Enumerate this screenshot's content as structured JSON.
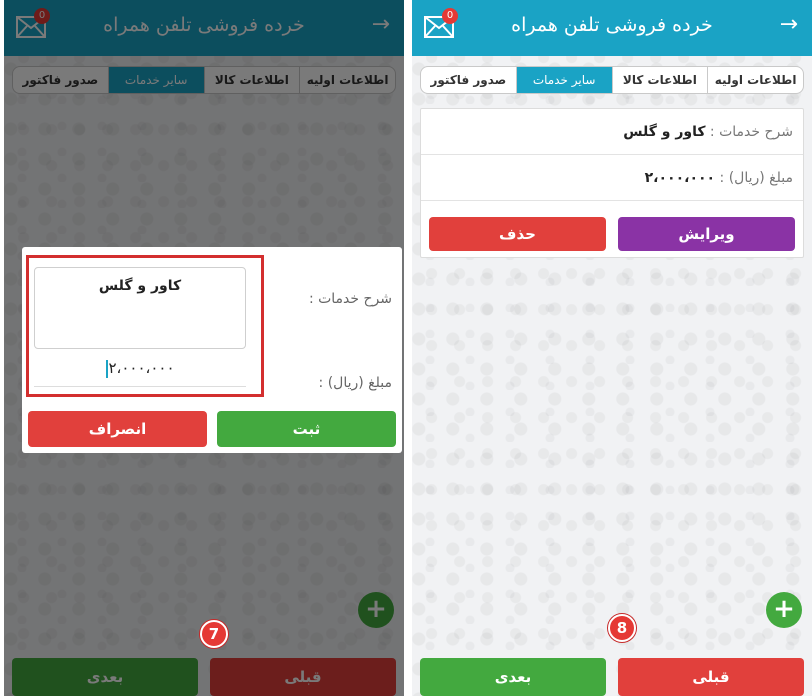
{
  "app": {
    "title": "خرده فروشی تلفن همراه",
    "back_icon": "→",
    "mail_badge": "0"
  },
  "tabs": [
    {
      "label": "اطلاعات اولیه"
    },
    {
      "label": "اطلاعات کالا"
    },
    {
      "label": "سایر خدمات"
    },
    {
      "label": "صدور فاکتور"
    }
  ],
  "right_screen": {
    "service_desc_label": "شرح خدمات : ",
    "service_desc_value": "کاور و گلس",
    "amount_label": "مبلغ (ریال) : ",
    "amount_value": "۲،۰۰۰،۰۰۰",
    "edit_button": "ویرایش",
    "delete_button": "حذف",
    "step_number": "8"
  },
  "left_screen": {
    "dialog_desc_label": "شرح خدمات :",
    "dialog_desc_value": "کاور و گلس",
    "dialog_amount_label": "مبلغ (ریال) :",
    "dialog_amount_value": "۲،۰۰۰،۰۰۰",
    "save_button": "ثبت",
    "cancel_button": "انصراف",
    "step_number": "7"
  },
  "bottom_nav": {
    "prev_label": "قبلی",
    "next_label": "بعدی"
  },
  "fab_label": "+",
  "colors": {
    "primary": "#1aa3c5",
    "green": "#43a93f",
    "red": "#e1403c",
    "purple": "#8a33a5"
  }
}
